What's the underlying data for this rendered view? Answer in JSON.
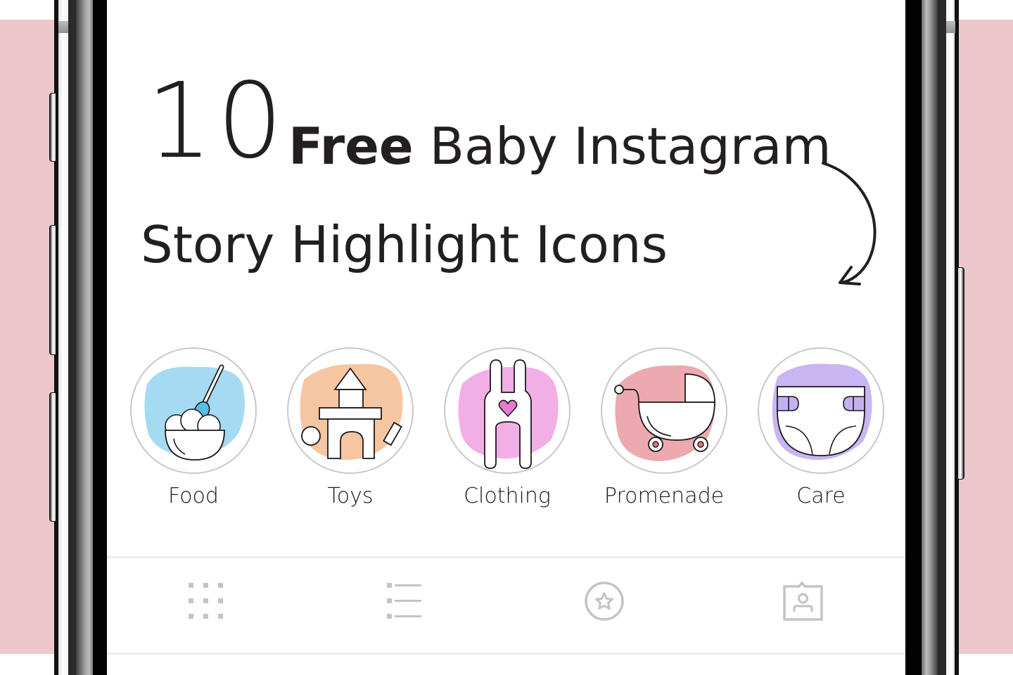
{
  "colors": {
    "background_band": "#ecc8cc",
    "text": "#231f20",
    "ring": "#c8c8c8",
    "tab_icon": "#c4c4c4",
    "food_wash": "#5bbde8",
    "toys_wash": "#f0a064",
    "clothing_wash": "#e87ad6",
    "promenade_wash": "#e0707a",
    "care_wash": "#9a78e6"
  },
  "headline": {
    "number": "10",
    "bold_word": "Free",
    "line1_rest": "Baby Instagram",
    "line2": "Story Highlight Icons"
  },
  "decorations": {
    "arrow": "curved-arrow-down-left"
  },
  "highlights": [
    {
      "label": "Food",
      "icon": "bowl-with-spoon-icon"
    },
    {
      "label": "Toys",
      "icon": "toy-blocks-castle-icon"
    },
    {
      "label": "Clothing",
      "icon": "baby-overalls-heart-icon"
    },
    {
      "label": "Promenade",
      "icon": "baby-stroller-icon"
    },
    {
      "label": "Care",
      "icon": "diaper-icon"
    }
  ],
  "tabbar": [
    {
      "name": "grid",
      "icon": "grid-icon"
    },
    {
      "name": "list",
      "icon": "list-icon"
    },
    {
      "name": "favorites",
      "icon": "star-circle-icon"
    },
    {
      "name": "tagged",
      "icon": "person-badge-icon"
    }
  ]
}
